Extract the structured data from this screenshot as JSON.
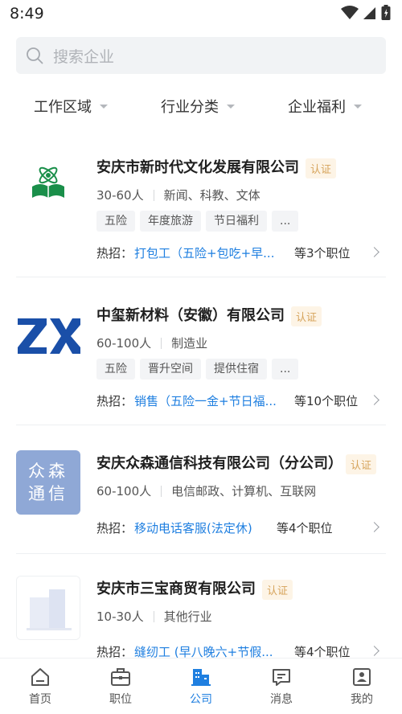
{
  "status_bar": {
    "time": "8:49"
  },
  "search": {
    "placeholder": "搜索企业"
  },
  "filters": [
    {
      "label": "工作区域"
    },
    {
      "label": "行业分类"
    },
    {
      "label": "企业福利"
    }
  ],
  "companies": [
    {
      "name": "安庆市新时代文化发展有限公司",
      "badge": "认证",
      "size": "30-60人",
      "industry": "新闻、科教、文体",
      "tags": [
        "五险",
        "年度旅游",
        "节日福利",
        "..."
      ],
      "hot_label": "热招：",
      "hot_job": "打包工（五险+包吃+早...",
      "job_count": "等3个职位"
    },
    {
      "name": "中玺新材料（安徽）有限公司",
      "badge": "认证",
      "size": "60-100人",
      "industry": "制造业",
      "tags": [
        "五险",
        "晋升空间",
        "提供住宿",
        "..."
      ],
      "hot_label": "热招：",
      "hot_job": "销售（五险一金+节日福...",
      "job_count": "等10个职位"
    },
    {
      "name": "安庆众森通信科技有限公司（分公司）",
      "badge": "认证",
      "size": "60-100人",
      "industry": "电信邮政、计算机、互联网",
      "logo_text": [
        "众森",
        "通信"
      ],
      "hot_label": "热招：",
      "hot_job": "移动电话客服(法定休)",
      "job_count": "等4个职位"
    },
    {
      "name": "安庆市三宝商贸有限公司",
      "badge": "认证",
      "size": "10-30人",
      "industry": "其他行业",
      "hot_label": "热招：",
      "hot_job": "缝纫工 (早八晚六+节假...",
      "job_count": "等4个职位"
    }
  ],
  "bottom_nav": [
    {
      "label": "首页",
      "icon": "home-icon"
    },
    {
      "label": "职位",
      "icon": "briefcase-icon"
    },
    {
      "label": "公司",
      "icon": "building-icon",
      "active": true
    },
    {
      "label": "消息",
      "icon": "message-icon"
    },
    {
      "label": "我的",
      "icon": "profile-icon"
    }
  ],
  "colors": {
    "accent": "#1f7fe0",
    "badge_text": "#d6a35a",
    "badge_bg": "#fdf4e6",
    "logo2_blue": "#1a4fa8",
    "logo3_bg": "#8fa8d6"
  }
}
